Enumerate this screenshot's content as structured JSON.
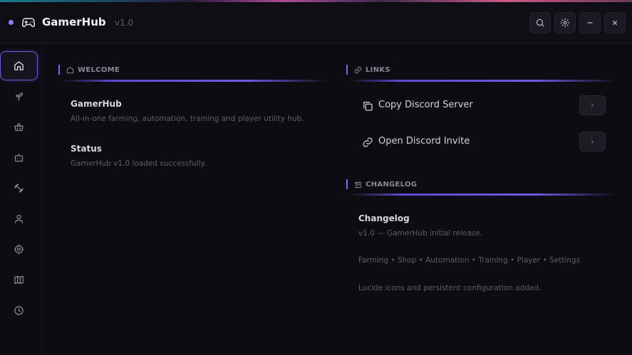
{
  "app": {
    "title": "GamerHub",
    "version": "v1.0"
  },
  "titlebar_buttons": [
    "search-icon",
    "gear-icon",
    "minimize-icon",
    "close-icon"
  ],
  "sidebar": {
    "items": [
      "home-icon",
      "sprout-icon",
      "basket-icon",
      "bot-icon",
      "dumbbell-icon",
      "user-icon",
      "gear-icon",
      "map-icon",
      "clock-icon"
    ],
    "active": 0
  },
  "welcome": {
    "header": "WELCOME",
    "blocks": [
      {
        "title": "GamerHub",
        "text": "All-in-one farming, automation, training and player utility hub."
      },
      {
        "title": "Status",
        "text": "GamerHub v1.0 loaded successfully."
      }
    ]
  },
  "links": {
    "header": "LINKS",
    "items": [
      {
        "label": "Copy Discord Server",
        "icon": "copy-icon",
        "action": "›"
      },
      {
        "label": "Open Discord Invite",
        "icon": "link-icon",
        "action": "›"
      }
    ]
  },
  "changelog": {
    "header": "CHANGELOG",
    "title": "Changelog",
    "lines": [
      "v1.0 — GamerHub initial release.",
      "Farming • Shop • Automation • Training • Player • Settings",
      "Lucide icons and persistent configuration added."
    ]
  },
  "colors": {
    "accent": "#7a6af0",
    "background": "#0d0c12",
    "panel": "#0f0e15"
  }
}
